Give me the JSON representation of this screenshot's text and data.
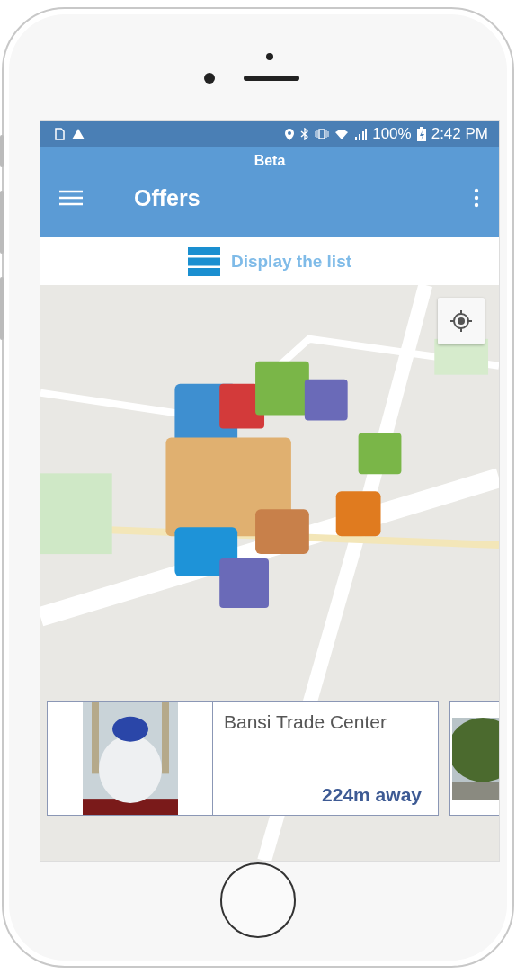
{
  "status_bar": {
    "battery": "100%",
    "time": "2:42 PM"
  },
  "app_bar": {
    "subtitle": "Beta",
    "title": "Offers"
  },
  "list_toggle": {
    "label": "Display the list"
  },
  "places": [
    {
      "kind": "full",
      "name": "Bansi Trade Center",
      "distance": "224m away"
    },
    {
      "kind": "peek"
    }
  ]
}
